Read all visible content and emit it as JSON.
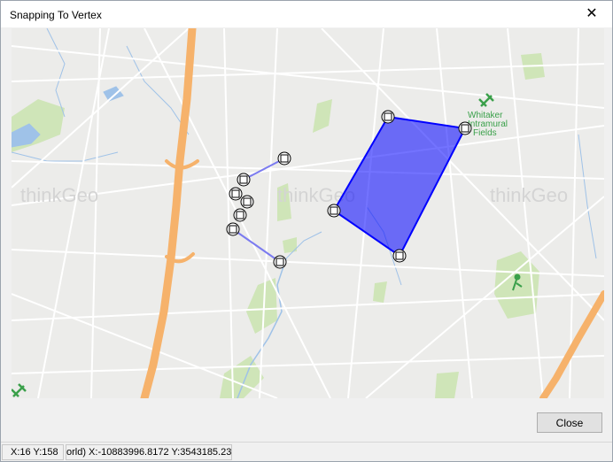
{
  "window": {
    "title": "Snapping To Vertex",
    "close_glyph": "✕"
  },
  "map": {
    "watermark": "thinkGeo",
    "poi_label": [
      "Whitaker",
      "Intramural",
      "Fields"
    ],
    "colors": {
      "background": "#ececea",
      "road": "#ffffff",
      "highway": "#f6b26b",
      "park": "#cfe5b8",
      "water": "#9fc2e8",
      "polygon_fill": "#0000ff",
      "polygon_stroke": "#0000ff",
      "line_stroke": "#7b7bf0",
      "vertex": "#000000",
      "poi_icon": "#3aa04a"
    }
  },
  "buttons": {
    "close_label": "Close"
  },
  "status": {
    "screen_coords": "X:16 Y:158",
    "world_coords": "orld) X:-10883996.8172 Y:3543185.23"
  }
}
